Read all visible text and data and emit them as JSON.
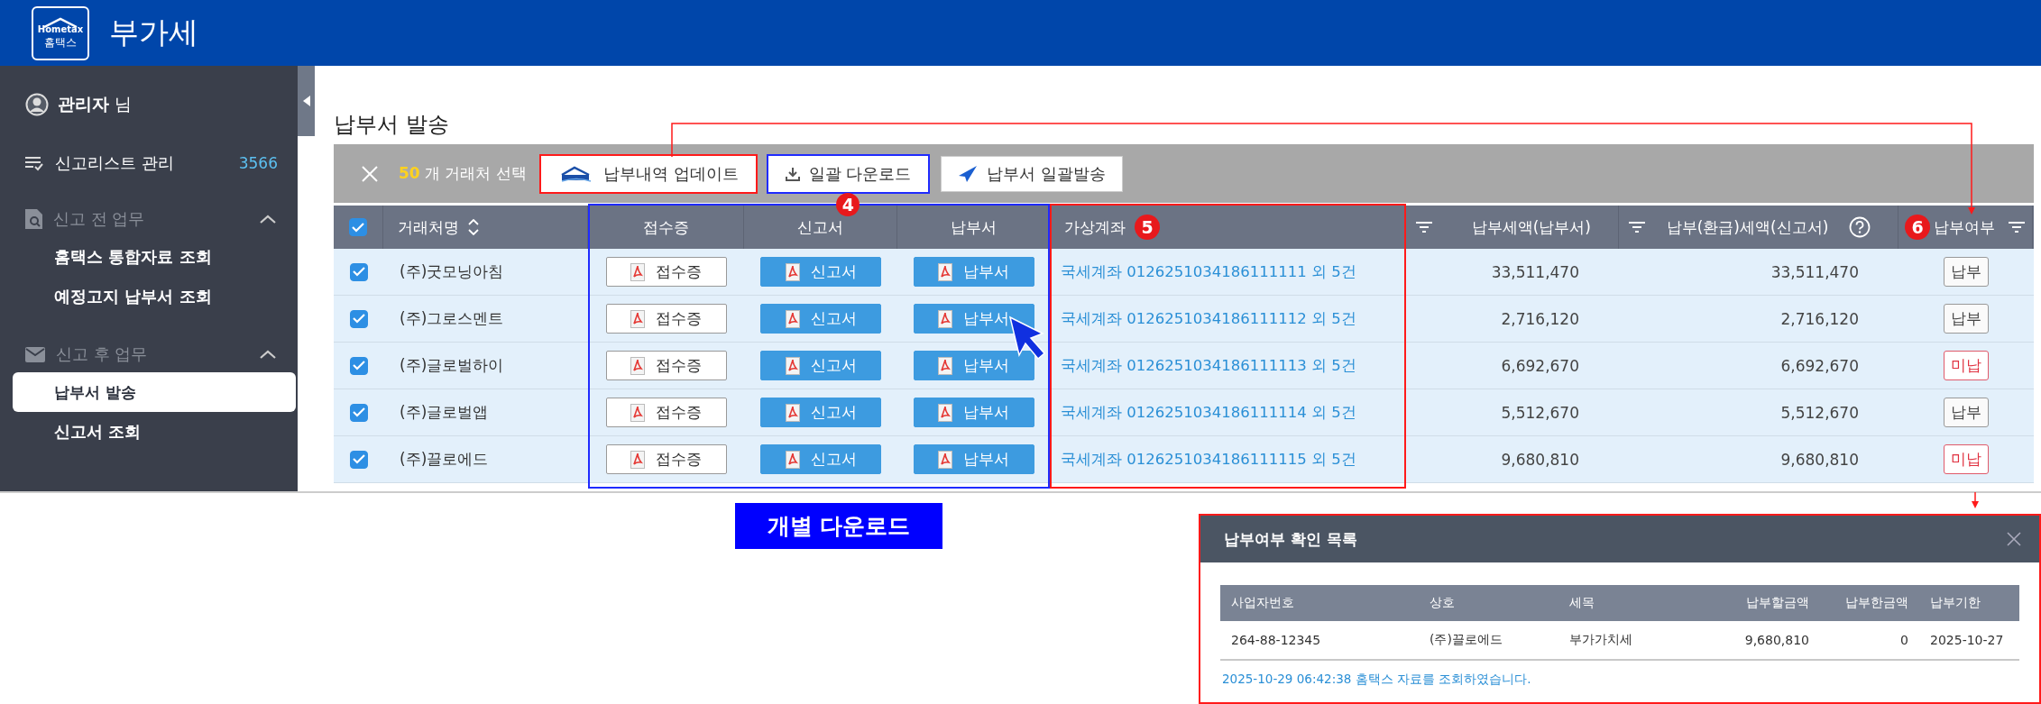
{
  "header": {
    "logo_wordmark": "Hometax",
    "logo_caption": "홈택스",
    "title": "부가세"
  },
  "sidebar": {
    "user": {
      "name": "관리자",
      "suffix": "님"
    },
    "items": [
      {
        "kind": "link",
        "label": "신고리스트 관리",
        "count": "3566"
      },
      {
        "kind": "group",
        "label": "신고 전 업무",
        "expanded": true,
        "children": [
          {
            "label": "홈택스 통합자료 조회",
            "selected": false
          },
          {
            "label": "예정고지 납부서 조회",
            "selected": false
          }
        ]
      },
      {
        "kind": "group",
        "label": "신고 후 업무",
        "expanded": true,
        "children": [
          {
            "label": "납부서 발송",
            "selected": true
          },
          {
            "label": "신고서 조회",
            "selected": false
          }
        ]
      }
    ]
  },
  "page_title": "납부서 발송",
  "toolbar": {
    "count": "50",
    "count_label": "개 거래처 선택",
    "buttons": [
      {
        "kind": "hometax",
        "label": "납부내역 업데이트",
        "color": "#ff1a1a"
      },
      {
        "kind": "download",
        "label": "일괄 다운로드",
        "color": "#1f2bff",
        "badge": "4"
      },
      {
        "kind": "send",
        "label": "납부서 일괄발송"
      }
    ]
  },
  "table": {
    "columns": [
      {
        "kind": "checkbox",
        "checked": true
      },
      {
        "kind": "sort",
        "label": "거래처명"
      },
      {
        "kind": "plain",
        "label": "접수증",
        "color": "#1f2bff"
      },
      {
        "kind": "plain",
        "label": "신고서",
        "color": "#1f2bff"
      },
      {
        "kind": "plain",
        "label": "납부서",
        "color": "#1f2bff"
      },
      {
        "kind": "plain",
        "label": "가상계좌",
        "color": "#ff1a1a",
        "badge": "5"
      },
      {
        "kind": "filter",
        "label": "납부세액(납부서)"
      },
      {
        "kind": "filter",
        "label": "납부(환급)세액(신고서)",
        "help": true
      },
      {
        "kind": "filter-end",
        "label": "납부여부",
        "badge": "6"
      }
    ],
    "rows": [
      {
        "checked": true,
        "name": "(주)굿모닝아침",
        "receipt": "접수증",
        "report": "신고서",
        "bill": "납부서",
        "account": "국세계좌 0126251034186111111 외 5건",
        "tax_bill": "33,511,470",
        "tax_report": "33,511,470",
        "status": "납부",
        "paid": true
      },
      {
        "checked": true,
        "name": "(주)그로스멘트",
        "receipt": "접수증",
        "report": "신고서",
        "bill": "납부서",
        "account": "국세계좌 0126251034186111112 외 5건",
        "tax_bill": "2,716,120",
        "tax_report": "2,716,120",
        "status": "납부",
        "paid": true
      },
      {
        "checked": true,
        "name": "(주)글로벌하이",
        "receipt": "접수증",
        "report": "신고서",
        "bill": "납부서",
        "account": "국세계좌 0126251034186111113 외 5건",
        "tax_bill": "6,692,670",
        "tax_report": "6,692,670",
        "status": "미납",
        "paid": false
      },
      {
        "checked": true,
        "name": "(주)글로벌앱",
        "receipt": "접수증",
        "report": "신고서",
        "bill": "납부서",
        "account": "국세계좌 0126251034186111114 외 5건",
        "tax_bill": "5,512,670",
        "tax_report": "5,512,670",
        "status": "납부",
        "paid": true
      },
      {
        "checked": true,
        "name": "(주)끌로에드",
        "receipt": "접수증",
        "report": "신고서",
        "bill": "납부서",
        "account": "국세계좌 0126251034186111115 외 5건",
        "tax_bill": "9,680,810",
        "tax_report": "9,680,810",
        "status": "미납",
        "paid": false
      }
    ]
  },
  "callout": {
    "label": "개별 다운로드"
  },
  "popup": {
    "title": "납부여부 확인 목록",
    "columns": [
      "사업자번호",
      "상호",
      "세목",
      "납부할금액",
      "납부한금액",
      "납부기한"
    ],
    "rows": [
      [
        "264-88-12345",
        "(주)끌로에드",
        "부가가치세",
        "9,680,810",
        "0",
        "2025-10-27"
      ]
    ],
    "note": "2025-10-29 06:42:38 홈택스 자료를 조회하였습니다."
  }
}
